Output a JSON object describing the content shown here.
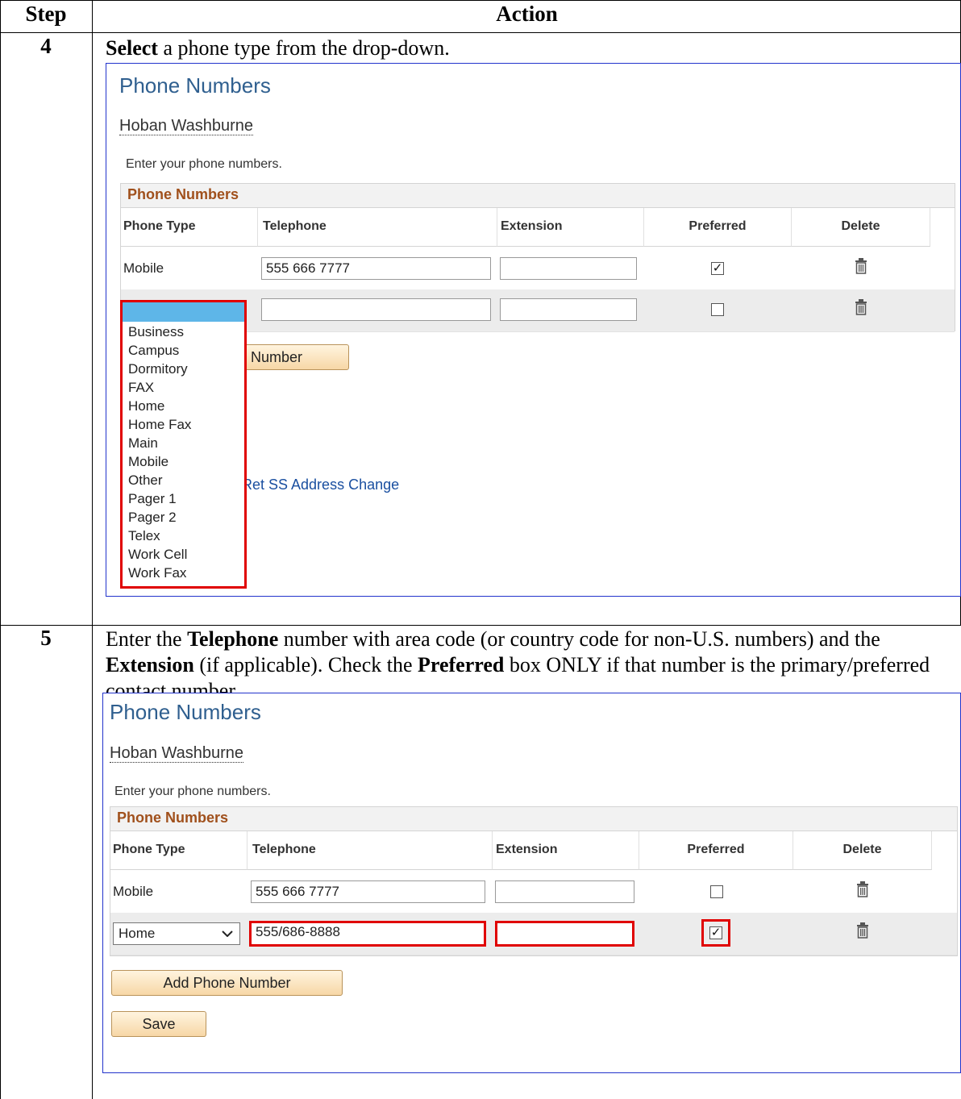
{
  "header": {
    "step": "Step",
    "action": "Action"
  },
  "step4": {
    "number": "4",
    "instruction_bold": "Select",
    "instruction_rest": " a phone type from the drop-down."
  },
  "step5": {
    "number": "5",
    "t1": "Enter the ",
    "b1": "Telephone",
    "t2": " number with area code (or country code for non-U.S. numbers) and the ",
    "b2": "Extension",
    "t3": " (if applicable).  Check the ",
    "b3": "Preferred",
    "t4": " box ONLY if that number is the primary/preferred contact number."
  },
  "shot1": {
    "title": "Phone Numbers",
    "name": "Hoban Washburne",
    "instructions": "Enter your phone numbers.",
    "grid_caption": "Phone Numbers",
    "columns": [
      "Phone Type",
      "Telephone",
      "Extension",
      "Preferred",
      "Delete"
    ],
    "row1": {
      "type": "Mobile",
      "telephone": "555 666 7777",
      "extension": "",
      "preferred": true
    },
    "row2": {
      "type": "",
      "telephone": "",
      "extension": "",
      "preferred": false
    },
    "add_button_partial": "Number",
    "link_partial": "Ret SS Address Change",
    "dropdown_options": [
      "Business",
      "Campus",
      "Dormitory",
      "FAX",
      "Home",
      "Home Fax",
      "Main",
      "Mobile",
      "Other",
      "Pager 1",
      "Pager 2",
      "Telex",
      "Work Cell",
      "Work Fax"
    ],
    "check_glyph": "✓"
  },
  "shot2": {
    "title": "Phone Numbers",
    "name": "Hoban Washburne",
    "instructions": "Enter your phone numbers.",
    "grid_caption": "Phone Numbers",
    "columns": [
      "Phone Type",
      "Telephone",
      "Extension",
      "Preferred",
      "Delete"
    ],
    "row1": {
      "type": "Mobile",
      "telephone": "555 666 7777",
      "extension": "",
      "preferred": false
    },
    "row2": {
      "type": "Home",
      "telephone": "555/686-8888",
      "extension": "",
      "preferred": true
    },
    "add_button": "Add Phone Number",
    "save_button": "Save",
    "check_glyph": "✓"
  },
  "colors": {
    "highlight": "#e00000",
    "link": "#1a4fa0",
    "title": "#2f5f8f",
    "caption": "#a0501c",
    "dropdown_selected": "#5eb6e8"
  }
}
